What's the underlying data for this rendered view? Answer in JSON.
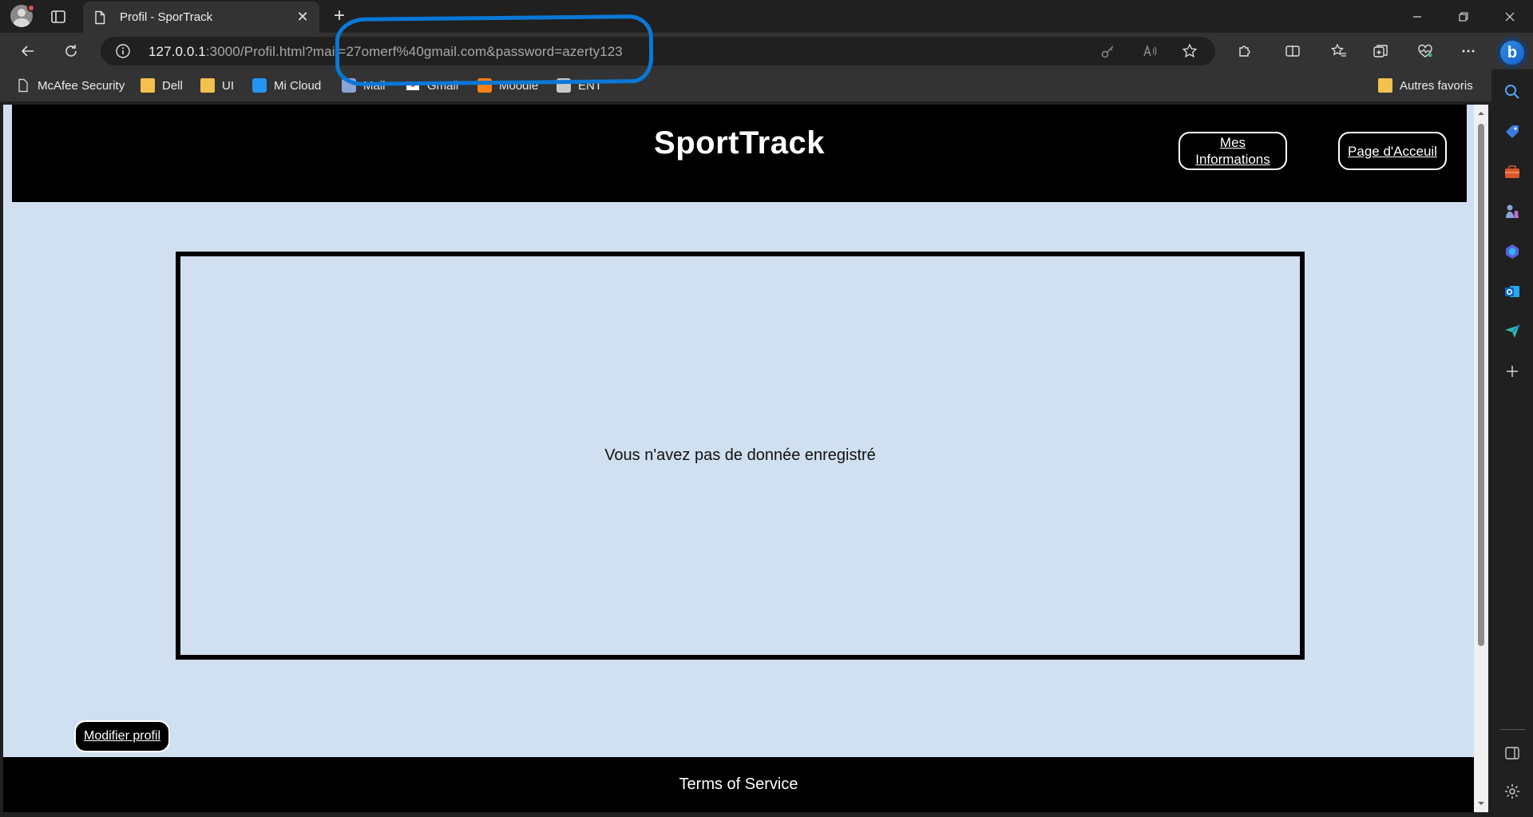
{
  "browser": {
    "tab": {
      "title": "Profil - SporTrack"
    },
    "address": {
      "host": "127.0.0.1",
      "rest": ":3000/Profil.html?mail=27omerf%40gmail.com&password=azerty123"
    },
    "bookmarks": [
      {
        "label": "McAfee Security",
        "icon": "page-icon"
      },
      {
        "label": "Dell",
        "icon": "folder-icon"
      },
      {
        "label": "UI",
        "icon": "folder-icon"
      },
      {
        "label": "Mi Cloud",
        "icon": "cloud-icon"
      },
      {
        "label": "Mail",
        "icon": "mail-icon"
      },
      {
        "label": "Gmail",
        "icon": "gmail-icon"
      },
      {
        "label": "Moodle",
        "icon": "moodle-icon"
      },
      {
        "label": "ENT",
        "icon": "ent-icon"
      }
    ],
    "other_favorites": "Autres favoris"
  },
  "site": {
    "brand": "SportTrack",
    "nav": {
      "info_line1": "Mes",
      "info_line2": "Informations",
      "home": "Page d'Acceuil"
    },
    "empty_message": "Vous n'avez pas de donnée enregistré",
    "edit_button": "Modifier profil",
    "footer": "Terms of Service"
  },
  "colors": {
    "page_background": "#d1e0f0",
    "header_background": "#000000",
    "annotation": "#0a78d7"
  }
}
